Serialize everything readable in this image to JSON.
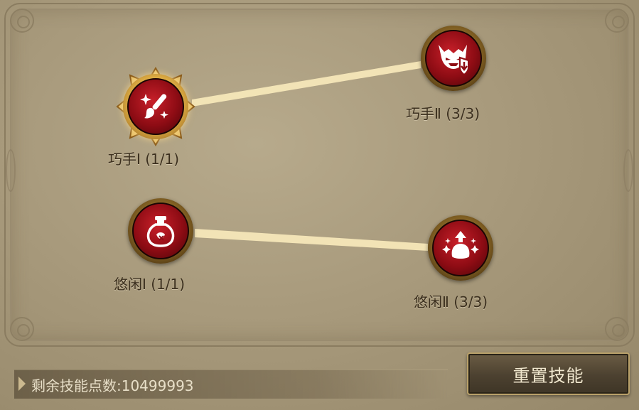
{
  "skills": [
    {
      "id": "qiaoshou-1",
      "label": "巧手Ⅰ (1/1)",
      "icon": "brush-sparkle-icon",
      "active": true
    },
    {
      "id": "qiaoshou-2",
      "label": "巧手Ⅱ (3/3)",
      "icon": "demon-shield-icon",
      "active": false
    },
    {
      "id": "youxian-1",
      "label": "悠闲Ⅰ (1/1)",
      "icon": "potion-bottle-icon",
      "active": false
    },
    {
      "id": "youxian-2",
      "label": "悠闲Ⅱ (3/3)",
      "icon": "ghost-arrow-icon",
      "active": false
    }
  ],
  "footer": {
    "points_label": "剩余技能点数:10499993",
    "reset_button": "重置技能"
  },
  "colors": {
    "background": "#a89a7c",
    "node_red": "#8e0c14",
    "node_gold": "#e3b247",
    "link": "#f6e7b8"
  }
}
